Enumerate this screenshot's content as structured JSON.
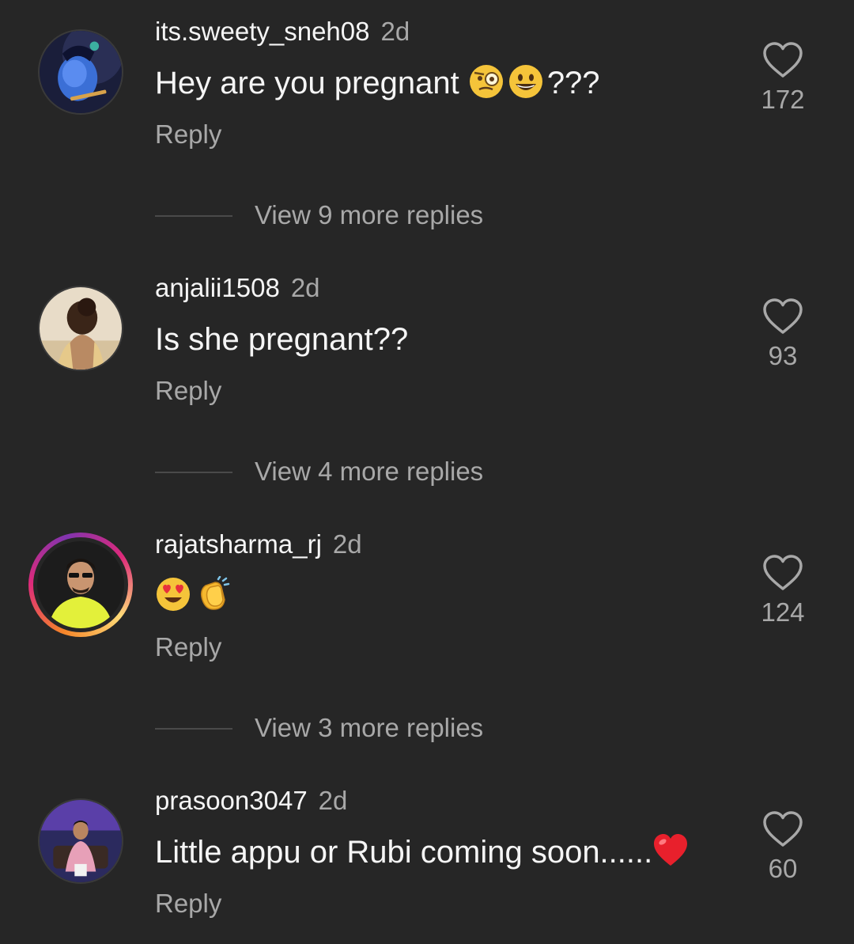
{
  "comments": [
    {
      "username": "its.sweety_sneh08",
      "time": "2d",
      "text": "Hey are you pregnant",
      "text_suffix": "???",
      "emojis": [
        "face-with-monocle-emoji",
        "grinning-face-emoji"
      ],
      "reply_label": "Reply",
      "likes": "172",
      "view_more": "View 9 more replies"
    },
    {
      "username": "anjalii1508",
      "time": "2d",
      "text": "Is she pregnant??",
      "reply_label": "Reply",
      "likes": "93",
      "view_more": "View 4 more replies"
    },
    {
      "username": "rajatsharma_rj",
      "time": "2d",
      "text": "",
      "emojis": [
        "heart-eyes-emoji",
        "clapping-hands-emoji"
      ],
      "reply_label": "Reply",
      "likes": "124",
      "view_more": "View 3 more replies",
      "has_story_ring": true
    },
    {
      "username": "prasoon3047",
      "time": "2d",
      "text": "Little appu or Rubi coming soon......",
      "emojis": [
        "red-heart-emoji"
      ],
      "reply_label": "Reply",
      "likes": "60"
    }
  ],
  "colors": {
    "background": "#262626",
    "primary_text": "#f5f5f5",
    "secondary_text": "#a8a8a8",
    "story_ring": [
      "#f58529",
      "#dd2a7b",
      "#8134af"
    ]
  },
  "icons": {
    "like": "heart-outline-icon"
  }
}
